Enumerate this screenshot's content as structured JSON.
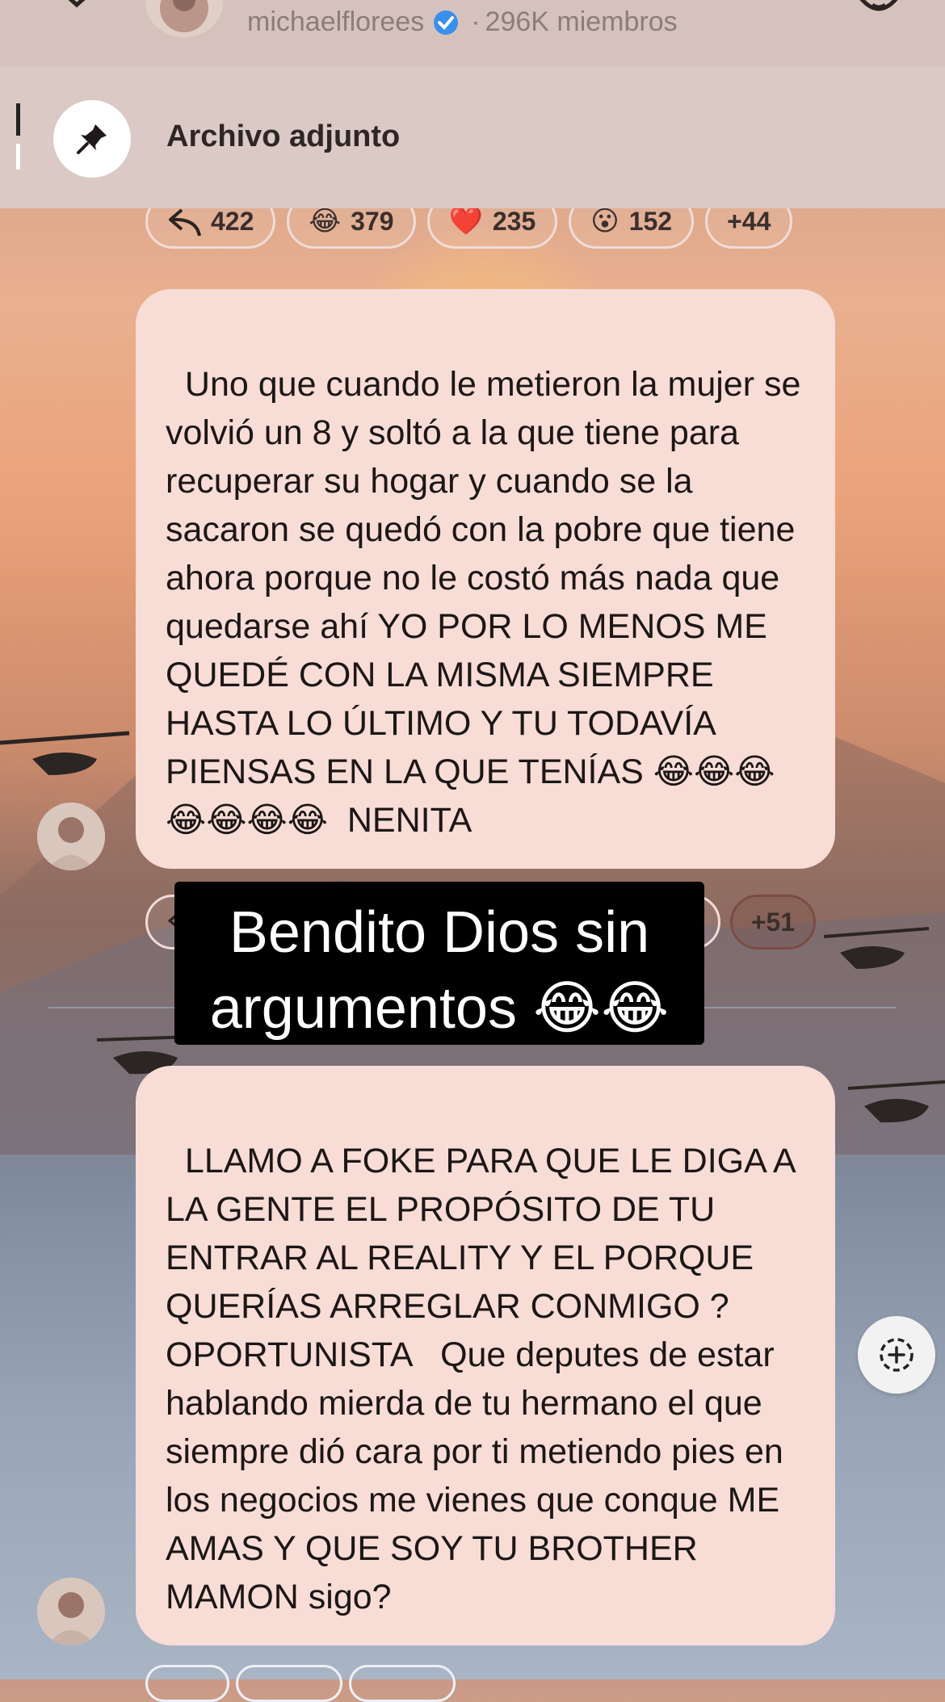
{
  "header": {
    "channel_name": "michaelflorees",
    "separator": "·",
    "member_count": "296K miembros"
  },
  "pinned": {
    "label": "Archivo adjunto"
  },
  "reactions_top": [
    {
      "icon": "reply-icon",
      "emoji": "",
      "count": "422"
    },
    {
      "icon": "laugh-emoji-icon",
      "emoji": "😂",
      "count": "379"
    },
    {
      "icon": "heart-emoji-icon",
      "emoji": "❤️",
      "count": "235"
    },
    {
      "icon": "surprised-emoji-icon",
      "emoji": "😮",
      "count": "152"
    },
    {
      "icon": "",
      "emoji": "",
      "count": "+44"
    }
  ],
  "message1": {
    "text": "Uno que cuando le metieron la mujer se volvió un 8 y soltó a la que tiene para recuperar su hogar y cuando se la sacaron se quedó con la pobre que tiene ahora porque no le costó más nada que quedarse ahí YO POR LO MENOS ME QUEDÉ CON LA MISMA SIEMPRE HASTA LO ÚLTIMO Y TU TODAVÍA PIENSAS EN LA QUE TENÍAS 😂😂😂😂😂😂😂  NENITA"
  },
  "reactions_mid": {
    "more_count": "+51"
  },
  "caption": {
    "line1": "Bendito Dios sin",
    "line2": "argumentos 😂😂"
  },
  "message2": {
    "text": "LLAMO A FOKE PARA QUE LE DIGA A LA GENTE EL PROPÓSITO DE TU ENTRAR AL REALITY Y EL PORQUE QUERÍAS ARREGLAR CONMIGO ? OPORTUNISTA   Que deputes de estar hablando mierda de tu hermano el que siempre dió cara por ti metiendo pies en los negocios me vienes que conque ME AMAS Y QUE SOY TU BROTHER MAMON sigo?"
  },
  "colors": {
    "bubble": "#f8dcd6",
    "header": "#d6c2bd",
    "verified": "#3a8fea"
  }
}
